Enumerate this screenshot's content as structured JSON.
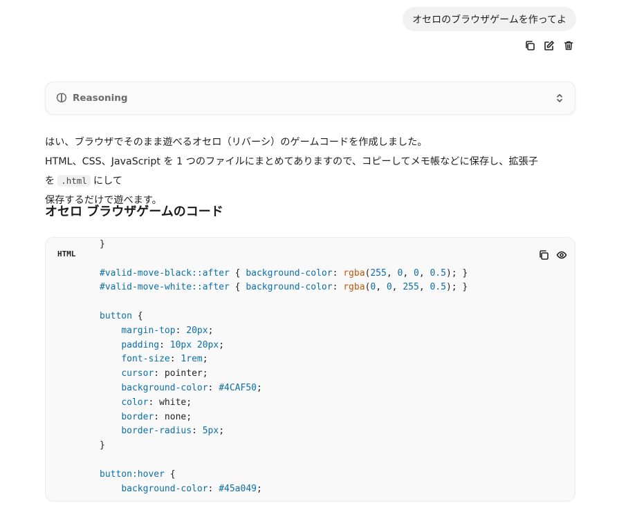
{
  "user_message": {
    "text": "オセロのブラウザゲームを作ってよ"
  },
  "message_actions": {
    "copy_icon": "copy-icon",
    "edit_icon": "edit-icon",
    "delete_icon": "trash-icon"
  },
  "reasoning": {
    "label": "Reasoning",
    "expanded": false
  },
  "answer": {
    "line1": "はい、ブラウザでそのまま遊べるオセロ（リバーシ）のゲームコードを作成しました。",
    "line2_before": "HTML、CSS、JavaScript を 1 つのファイルにまとめてありますので、コピーしてメモ帳などに保存し、拡張子を",
    "line2_code": ".html",
    "line2_after": "にして",
    "line3": "保存するだけで遊べます。"
  },
  "heading": "オセロ ブラウザゲームのコード",
  "code_block": {
    "language": "HTML",
    "lines": [
      [
        [
          "tok-plain",
          "}"
        ]
      ],
      [],
      [
        [
          "tok-sel",
          "#valid-move-black::after"
        ],
        [
          "tok-plain",
          " { "
        ],
        [
          "tok-prop",
          "background-color"
        ],
        [
          "tok-plain",
          ": "
        ],
        [
          "tok-fn",
          "rgba"
        ],
        [
          "tok-plain",
          "("
        ],
        [
          "tok-num",
          "255"
        ],
        [
          "tok-plain",
          ", "
        ],
        [
          "tok-num",
          "0"
        ],
        [
          "tok-plain",
          ", "
        ],
        [
          "tok-num",
          "0"
        ],
        [
          "tok-plain",
          ", "
        ],
        [
          "tok-num",
          "0.5"
        ],
        [
          "tok-plain",
          "); }"
        ]
      ],
      [
        [
          "tok-sel",
          "#valid-move-white::after"
        ],
        [
          "tok-plain",
          " { "
        ],
        [
          "tok-prop",
          "background-color"
        ],
        [
          "tok-plain",
          ": "
        ],
        [
          "tok-fn",
          "rgba"
        ],
        [
          "tok-plain",
          "("
        ],
        [
          "tok-num",
          "0"
        ],
        [
          "tok-plain",
          ", "
        ],
        [
          "tok-num",
          "0"
        ],
        [
          "tok-plain",
          ", "
        ],
        [
          "tok-num",
          "255"
        ],
        [
          "tok-plain",
          ", "
        ],
        [
          "tok-num",
          "0.5"
        ],
        [
          "tok-plain",
          "); }"
        ]
      ],
      [],
      [
        [
          "tok-sel",
          "button"
        ],
        [
          "tok-plain",
          " {"
        ]
      ],
      [
        [
          "tok-plain",
          "    "
        ],
        [
          "tok-prop",
          "margin-top"
        ],
        [
          "tok-plain",
          ": "
        ],
        [
          "tok-num",
          "20px"
        ],
        [
          "tok-plain",
          ";"
        ]
      ],
      [
        [
          "tok-plain",
          "    "
        ],
        [
          "tok-prop",
          "padding"
        ],
        [
          "tok-plain",
          ": "
        ],
        [
          "tok-num",
          "10px 20px"
        ],
        [
          "tok-plain",
          ";"
        ]
      ],
      [
        [
          "tok-plain",
          "    "
        ],
        [
          "tok-prop",
          "font-size"
        ],
        [
          "tok-plain",
          ": "
        ],
        [
          "tok-num",
          "1rem"
        ],
        [
          "tok-plain",
          ";"
        ]
      ],
      [
        [
          "tok-plain",
          "    "
        ],
        [
          "tok-prop",
          "cursor"
        ],
        [
          "tok-plain",
          ": pointer;"
        ]
      ],
      [
        [
          "tok-plain",
          "    "
        ],
        [
          "tok-prop",
          "background-color"
        ],
        [
          "tok-plain",
          ": "
        ],
        [
          "tok-num",
          "#4CAF50"
        ],
        [
          "tok-plain",
          ";"
        ]
      ],
      [
        [
          "tok-plain",
          "    "
        ],
        [
          "tok-prop",
          "color"
        ],
        [
          "tok-plain",
          ": white;"
        ]
      ],
      [
        [
          "tok-plain",
          "    "
        ],
        [
          "tok-prop",
          "border"
        ],
        [
          "tok-plain",
          ": none;"
        ]
      ],
      [
        [
          "tok-plain",
          "    "
        ],
        [
          "tok-prop",
          "border-radius"
        ],
        [
          "tok-plain",
          ": "
        ],
        [
          "tok-num",
          "5px"
        ],
        [
          "tok-plain",
          ";"
        ]
      ],
      [
        [
          "tok-plain",
          "}"
        ]
      ],
      [],
      [
        [
          "tok-sel",
          "button:hover"
        ],
        [
          "tok-plain",
          " {"
        ]
      ],
      [
        [
          "tok-plain",
          "    "
        ],
        [
          "tok-prop",
          "background-color"
        ],
        [
          "tok-plain",
          ": "
        ],
        [
          "tok-num",
          "#45a049"
        ],
        [
          "tok-plain",
          ";"
        ]
      ]
    ]
  },
  "code_actions": {
    "copy_icon": "copy-icon",
    "preview_icon": "eye-icon"
  },
  "colors": {
    "selector": "#0b6fa8",
    "function": "#c2570c",
    "code_bg": "#f9f9f9",
    "bubble_bg": "#f1f1f1"
  }
}
